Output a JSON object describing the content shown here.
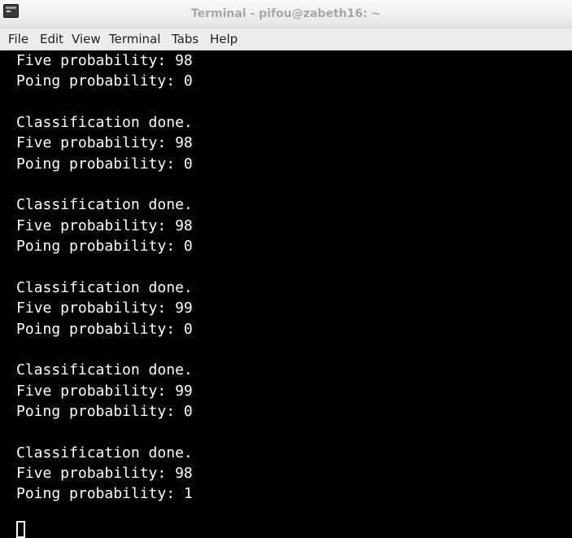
{
  "window": {
    "title": "Terminal - pifou@zabeth16: ~"
  },
  "menubar": {
    "items": [
      "File",
      "Edit",
      "View",
      "Terminal",
      "Tabs",
      "Help"
    ]
  },
  "terminal": {
    "lines": [
      "Five probability: 98",
      "Poing probability: 0",
      "",
      "Classification done.",
      "Five probability: 98",
      "Poing probability: 0",
      "",
      "Classification done.",
      "Five probability: 98",
      "Poing probability: 0",
      "",
      "Classification done.",
      "Five probability: 99",
      "Poing probability: 0",
      "",
      "Classification done.",
      "Five probability: 99",
      "Poing probability: 0",
      "",
      "Classification done.",
      "Five probability: 98",
      "Poing probability: 1"
    ],
    "colors": {
      "background": "#000000",
      "foreground": "#ffffff"
    }
  }
}
